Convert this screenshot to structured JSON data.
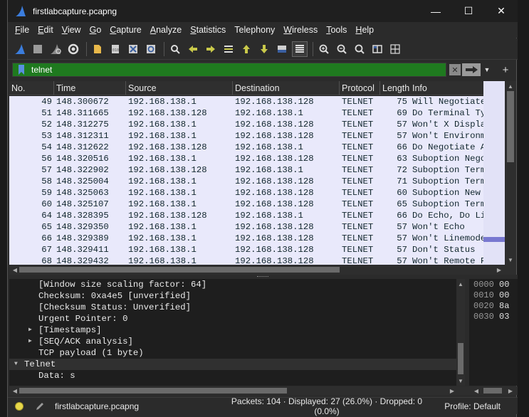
{
  "window": {
    "title": "firstlabcapture.pcapng",
    "minimize": "—",
    "maximize": "☐",
    "close": "✕"
  },
  "menu": [
    {
      "key": "F",
      "rest": "ile"
    },
    {
      "key": "E",
      "rest": "dit"
    },
    {
      "key": "V",
      "rest": "iew"
    },
    {
      "key": "G",
      "rest": "o"
    },
    {
      "key": "C",
      "rest": "apture"
    },
    {
      "key": "A",
      "rest": "nalyze"
    },
    {
      "key": "S",
      "rest": "tatistics"
    },
    {
      "key": "",
      "rest": "Telephony"
    },
    {
      "key": "W",
      "rest": "ireless"
    },
    {
      "key": "T",
      "rest": "ools"
    },
    {
      "key": "H",
      "rest": "elp"
    }
  ],
  "filter": {
    "value": "telnet",
    "color": "#1f7a1f"
  },
  "packet_list": {
    "columns": [
      "No.",
      "Time",
      "Source",
      "Destination",
      "Protocol",
      "Length",
      "Info"
    ],
    "rows": [
      {
        "no": "49",
        "time": "148.300672",
        "src": "192.168.138.1",
        "dst": "192.168.138.128",
        "proto": "TELNET",
        "len": "75",
        "info": "Will Negotiate"
      },
      {
        "no": "51",
        "time": "148.311665",
        "src": "192.168.138.128",
        "dst": "192.168.138.1",
        "proto": "TELNET",
        "len": "69",
        "info": "Do Terminal Ty"
      },
      {
        "no": "52",
        "time": "148.312275",
        "src": "192.168.138.1",
        "dst": "192.168.138.128",
        "proto": "TELNET",
        "len": "57",
        "info": "Won't X Displa"
      },
      {
        "no": "53",
        "time": "148.312311",
        "src": "192.168.138.1",
        "dst": "192.168.138.128",
        "proto": "TELNET",
        "len": "57",
        "info": "Won't Environm"
      },
      {
        "no": "54",
        "time": "148.312622",
        "src": "192.168.138.128",
        "dst": "192.168.138.1",
        "proto": "TELNET",
        "len": "66",
        "info": "Do Negotiate A"
      },
      {
        "no": "56",
        "time": "148.320516",
        "src": "192.168.138.1",
        "dst": "192.168.138.128",
        "proto": "TELNET",
        "len": "63",
        "info": "Suboption Nego"
      },
      {
        "no": "57",
        "time": "148.322902",
        "src": "192.168.138.128",
        "dst": "192.168.138.1",
        "proto": "TELNET",
        "len": "72",
        "info": "Suboption Term"
      },
      {
        "no": "58",
        "time": "148.325004",
        "src": "192.168.138.1",
        "dst": "192.168.138.128",
        "proto": "TELNET",
        "len": "71",
        "info": "Suboption Term"
      },
      {
        "no": "59",
        "time": "148.325063",
        "src": "192.168.138.1",
        "dst": "192.168.138.128",
        "proto": "TELNET",
        "len": "60",
        "info": "Suboption New"
      },
      {
        "no": "60",
        "time": "148.325107",
        "src": "192.168.138.1",
        "dst": "192.168.138.128",
        "proto": "TELNET",
        "len": "65",
        "info": "Suboption Term"
      },
      {
        "no": "64",
        "time": "148.328395",
        "src": "192.168.138.128",
        "dst": "192.168.138.1",
        "proto": "TELNET",
        "len": "66",
        "info": "Do Echo, Do Li"
      },
      {
        "no": "65",
        "time": "148.329350",
        "src": "192.168.138.1",
        "dst": "192.168.138.128",
        "proto": "TELNET",
        "len": "57",
        "info": "Won't Echo"
      },
      {
        "no": "66",
        "time": "148.329389",
        "src": "192.168.138.1",
        "dst": "192.168.138.128",
        "proto": "TELNET",
        "len": "57",
        "info": "Won't Linemode"
      },
      {
        "no": "67",
        "time": "148.329411",
        "src": "192.168.138.1",
        "dst": "192.168.138.128",
        "proto": "TELNET",
        "len": "57",
        "info": "Don't Status"
      },
      {
        "no": "68",
        "time": "148.329432",
        "src": "192.168.138.1",
        "dst": "192.168.138.128",
        "proto": "TELNET",
        "len": "57",
        "info": "Won't Remote F"
      }
    ],
    "row_bg": "#e9e9fb",
    "row_fg": "#12272e"
  },
  "details": {
    "rows": [
      {
        "text": "[Window size scaling factor: 64]",
        "indent": 2,
        "expander": ""
      },
      {
        "text": "Checksum: 0xa4e5 [unverified]",
        "indent": 2,
        "expander": ""
      },
      {
        "text": "[Checksum Status: Unverified]",
        "indent": 2,
        "expander": ""
      },
      {
        "text": "Urgent Pointer: 0",
        "indent": 2,
        "expander": ""
      },
      {
        "text": "[Timestamps]",
        "indent": 2,
        "expander": "collapsed"
      },
      {
        "text": "[SEQ/ACK analysis]",
        "indent": 2,
        "expander": "collapsed"
      },
      {
        "text": "TCP payload (1 byte)",
        "indent": 2,
        "expander": ""
      },
      {
        "text": "Telnet",
        "indent": 1,
        "expander": "expanded"
      },
      {
        "text": "Data: s",
        "indent": 2,
        "expander": ""
      }
    ]
  },
  "bytes": {
    "rows": [
      {
        "offset": "0000",
        "hex": "00"
      },
      {
        "offset": "0010",
        "hex": "00"
      },
      {
        "offset": "0020",
        "hex": "8a"
      },
      {
        "offset": "0030",
        "hex": "03"
      }
    ]
  },
  "status": {
    "file": "firstlabcapture.pcapng",
    "stats": "Packets: 104 · Displayed: 27 (26.0%) · Dropped: 0 (0.0%)",
    "profile": "Profile: Default"
  }
}
